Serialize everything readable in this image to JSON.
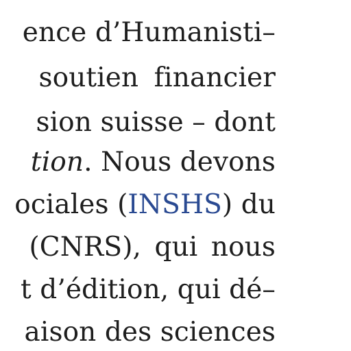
{
  "lines": [
    {
      "text": "ence d’Humanisti–"
    },
    {
      "text": "soutien financier"
    },
    {
      "text": "sion suisse – dont"
    },
    {
      "italic": "tion",
      "rest": ". Nous devons"
    },
    {
      "before": "ociales (",
      "link": "INSHS",
      "after": ") du"
    },
    {
      "text": "(CNRS), qui nous"
    },
    {
      "text": "t d’édition, qui dé–"
    },
    {
      "text": "aison des sciences"
    }
  ],
  "colors": {
    "text": "#1e1e1e",
    "link": "#2a4a92",
    "background": "#ffffff"
  }
}
